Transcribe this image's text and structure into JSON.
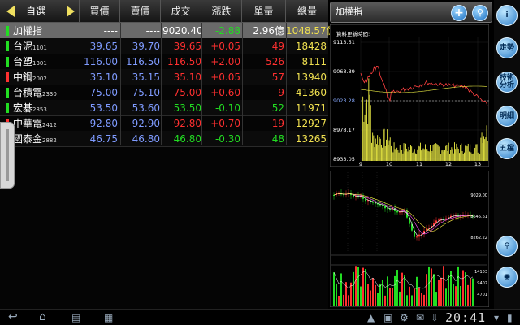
{
  "watchlist": {
    "title": "自選一"
  },
  "columns": {
    "buy": "買價",
    "sell": "賣價",
    "last": "成交",
    "change": "漲跌",
    "volume": "單量",
    "total": "總量"
  },
  "rows": [
    {
      "name": "加權指",
      "code": "",
      "buy": "----",
      "sell": "----",
      "last": "9020.40",
      "change": "-2.88",
      "volume": "2.96億",
      "total": "1048.57億",
      "mark": "#22dd22",
      "dir": "dn",
      "selected": true
    },
    {
      "name": "台泥",
      "code": "1101",
      "buy": "39.65",
      "sell": "39.70",
      "last": "39.65",
      "change": "+0.05",
      "volume": "49",
      "total": "18428",
      "mark": "#22dd22",
      "dir": "up",
      "selected": false
    },
    {
      "name": "台塑",
      "code": "1301",
      "buy": "116.00",
      "sell": "116.50",
      "last": "116.50",
      "change": "+2.00",
      "volume": "526",
      "total": "8111",
      "mark": "#22dd22",
      "dir": "up",
      "selected": false
    },
    {
      "name": "中鋼",
      "code": "2002",
      "buy": "35.10",
      "sell": "35.15",
      "last": "35.10",
      "change": "+0.05",
      "volume": "57",
      "total": "13940",
      "mark": "#ff3030",
      "dir": "up",
      "selected": false
    },
    {
      "name": "台積電",
      "code": "2330",
      "buy": "75.00",
      "sell": "75.10",
      "last": "75.00",
      "change": "+0.60",
      "volume": "9",
      "total": "41360",
      "mark": "#22dd22",
      "dir": "up",
      "selected": false
    },
    {
      "name": "宏碁",
      "code": "2353",
      "buy": "53.50",
      "sell": "53.60",
      "last": "53.50",
      "change": "-0.10",
      "volume": "52",
      "total": "11971",
      "mark": "#22dd22",
      "dir": "dn",
      "selected": false
    },
    {
      "name": "中華電",
      "code": "2412",
      "buy": "92.80",
      "sell": "92.90",
      "last": "92.80",
      "change": "+0.70",
      "volume": "19",
      "total": "12927",
      "mark": "#ff3030",
      "dir": "up",
      "selected": false
    },
    {
      "name": "國泰金",
      "code": "2882",
      "buy": "46.75",
      "sell": "46.80",
      "last": "46.80",
      "change": "-0.30",
      "volume": "48",
      "total": "13265",
      "mark": "#22dd22",
      "dir": "dn",
      "selected": false
    }
  ],
  "chart_header": {
    "title": "加權指",
    "add_icon": "plus-icon",
    "search_icon": "magnifier-icon"
  },
  "intraday": {
    "update_label": "資料更新時間:",
    "y_ticks": [
      "9113.51",
      "9068.39",
      "9023.28",
      "8978.17",
      "8933.05"
    ],
    "x_ticks": [
      "9",
      "10",
      "11",
      "12",
      "13"
    ]
  },
  "kline": {
    "price_ticks": [
      "9029.00",
      "8645.61",
      "8262.22"
    ],
    "volume_ticks": [
      "14103",
      "9402",
      "4701"
    ]
  },
  "side_toolbar": [
    {
      "label": "i",
      "icon": "info-icon"
    },
    {
      "label": "走勢",
      "icon": ""
    },
    {
      "label": "技術分析",
      "icon": ""
    },
    {
      "label": "明細",
      "icon": ""
    },
    {
      "label": "五檔",
      "icon": ""
    },
    {
      "label": "",
      "icon": "zoom-icon"
    },
    {
      "label": "",
      "icon": "settings-icon"
    }
  ],
  "system": {
    "clock": "20:41"
  }
}
